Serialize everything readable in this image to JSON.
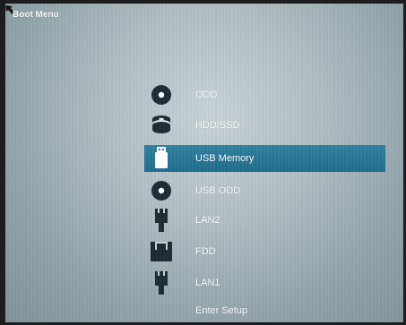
{
  "header": {
    "title": "Boot Menu"
  },
  "boot_menu": {
    "selected_index": 2,
    "items": [
      {
        "label": "ODD",
        "icon": "disc-icon"
      },
      {
        "label": "HDD/SSD",
        "icon": "hard-drive-icon"
      },
      {
        "label": "USB Memory",
        "icon": "usb-memory-icon"
      },
      {
        "label": "USB ODD",
        "icon": "disc-icon"
      },
      {
        "label": "LAN2",
        "icon": "network-plug-icon"
      },
      {
        "label": "FDD",
        "icon": "floppy-icon"
      },
      {
        "label": "LAN1",
        "icon": "network-plug-icon"
      },
      {
        "label": "Enter Setup",
        "icon": ""
      }
    ]
  },
  "colors": {
    "highlight": "#2a7797",
    "icon": "#1b2a33",
    "text": "#ffffff"
  }
}
